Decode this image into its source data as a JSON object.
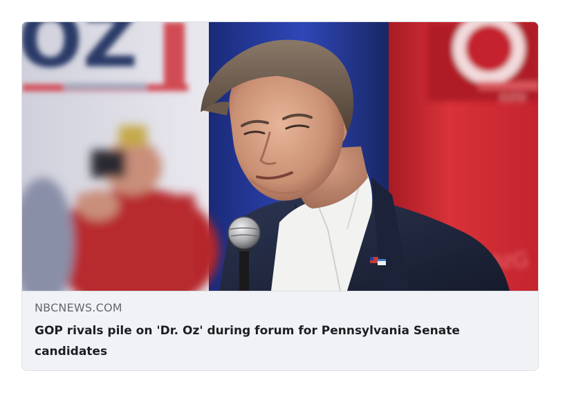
{
  "card": {
    "domain": "NBCNEWS.COM",
    "title": "GOP rivals pile on 'Dr. Oz' during forum for Pennsylvania Senate candidates",
    "image": {
      "subject": "man-with-microphone-photo",
      "sign_letters": "OZ"
    }
  },
  "colors": {
    "card_background": "#f0f2f5",
    "card_border": "#dcdfe3",
    "domain_text": "#65676b",
    "title_text": "#1c1e21",
    "backdrop_red": "#c8232c",
    "backdrop_blue": "#1e2f7a",
    "sign_navy": "#2b3a67"
  }
}
